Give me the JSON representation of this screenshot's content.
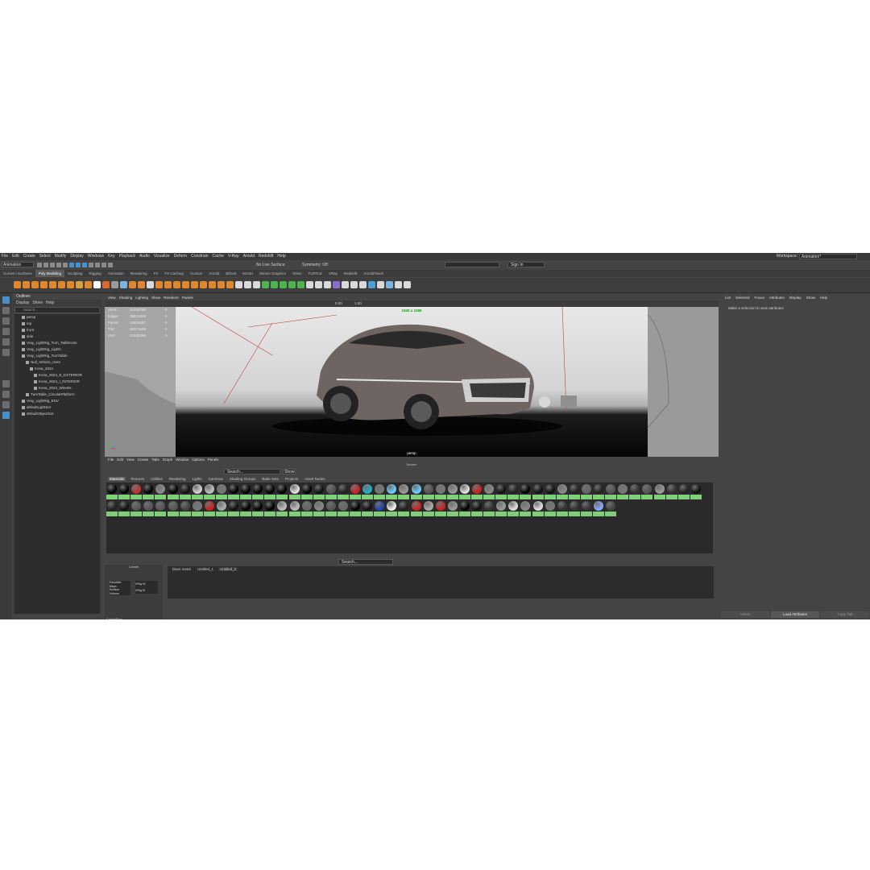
{
  "menubar": [
    "File",
    "Edit",
    "Create",
    "Select",
    "Modify",
    "Display",
    "Windows",
    "Key",
    "Playback",
    "Audio",
    "Visualize",
    "Deform",
    "Constrain",
    "Cache",
    "V-Ray",
    "Arnold",
    "Redshift",
    "Help"
  ],
  "workspace": {
    "label": "Workspace:",
    "value": "Animation*"
  },
  "status": {
    "mode": "Animation",
    "live_surface": "No Live Surface",
    "symmetry": "Symmetry: Off",
    "sign_in": "Sign In"
  },
  "shelf_tabs": [
    "Curves / Surfaces",
    "Poly Modeling",
    "Sculpting",
    "Rigging",
    "Animation",
    "Rendering",
    "FX",
    "FX Caching",
    "Custom",
    "Arnold",
    "Bifrost",
    "MASH",
    "Motion Graphics",
    "XGen",
    "TURTLE",
    "VRay",
    "Redshift",
    "ArnoldTeach"
  ],
  "shelf_active": "Poly Modeling",
  "outliner": {
    "title": "Outliner",
    "menu": [
      "Display",
      "Show",
      "Help"
    ],
    "search": "Search...",
    "items": [
      "persp",
      "top",
      "front",
      "side",
      "Vray_LightRig_Turn_TableCam",
      "Vray_LightRig_Lights",
      "Vray_LightRig_TurnTable",
      "Null_Vehicle_Here",
      "Kona_2024",
      "Kona_2024_E_EXTERIOR",
      "Kona_2024_I_INTERIOR",
      "Kona_2024_Wheels",
      "TurnTable_CircularPlatform",
      "Vray_LightRig_ENV",
      "defaultLightSet",
      "defaultObjectSet"
    ]
  },
  "viewport": {
    "menu": [
      "View",
      "Shading",
      "Lighting",
      "Show",
      "Renderer",
      "Panels"
    ],
    "hud": [
      {
        "label": "Verts:",
        "value": "21492790",
        "sel": "0"
      },
      {
        "label": "Edges:",
        "value": "39616848",
        "sel": "0"
      },
      {
        "label": "Faces:",
        "value": "20626587",
        "sel": "0"
      },
      {
        "label": "Tris:",
        "value": "20071689",
        "sel": "0"
      },
      {
        "label": "UVs:",
        "value": "21535066",
        "sel": "0"
      }
    ],
    "resolution": "1920 x 1080",
    "camera": "persp",
    "field_a": "0.00",
    "field_b": "1.00"
  },
  "hypershade": {
    "menu": [
      "File",
      "Edit",
      "View",
      "Create",
      "Tabs",
      "Graph",
      "Window",
      "Options",
      "Panels"
    ],
    "title": "Browser",
    "search": "Search...",
    "show": "Show",
    "tabs": [
      "Materials",
      "Textures",
      "Utilities",
      "Rendering",
      "Lights",
      "Cameras",
      "Shading Groups",
      "Bake Sets",
      "Projects",
      "Asset Nodes"
    ],
    "active_tab": "Materials",
    "create_title": "Create",
    "create_items": [
      "Favorites",
      "Maya",
      "Surface",
      "Volume"
    ],
    "vray_items": [
      "VRay M",
      "VRay B"
    ],
    "bottom_tabs": [
      "Create",
      "Bins"
    ],
    "work_tabs": [
      "black metal",
      "Untitled_1",
      "Untitled_2"
    ],
    "work_search": "Search..."
  },
  "attribute_editor": {
    "menu": [
      "List",
      "Selected",
      "Focus",
      "Attributes",
      "Display",
      "Show",
      "Help"
    ],
    "message": "Make a selection to view attributes",
    "buttons": [
      "Select",
      "Load Attributes",
      "Copy Tab"
    ]
  },
  "colors": {
    "accent": "#4a90c8",
    "material_label": "#7fcf78"
  }
}
